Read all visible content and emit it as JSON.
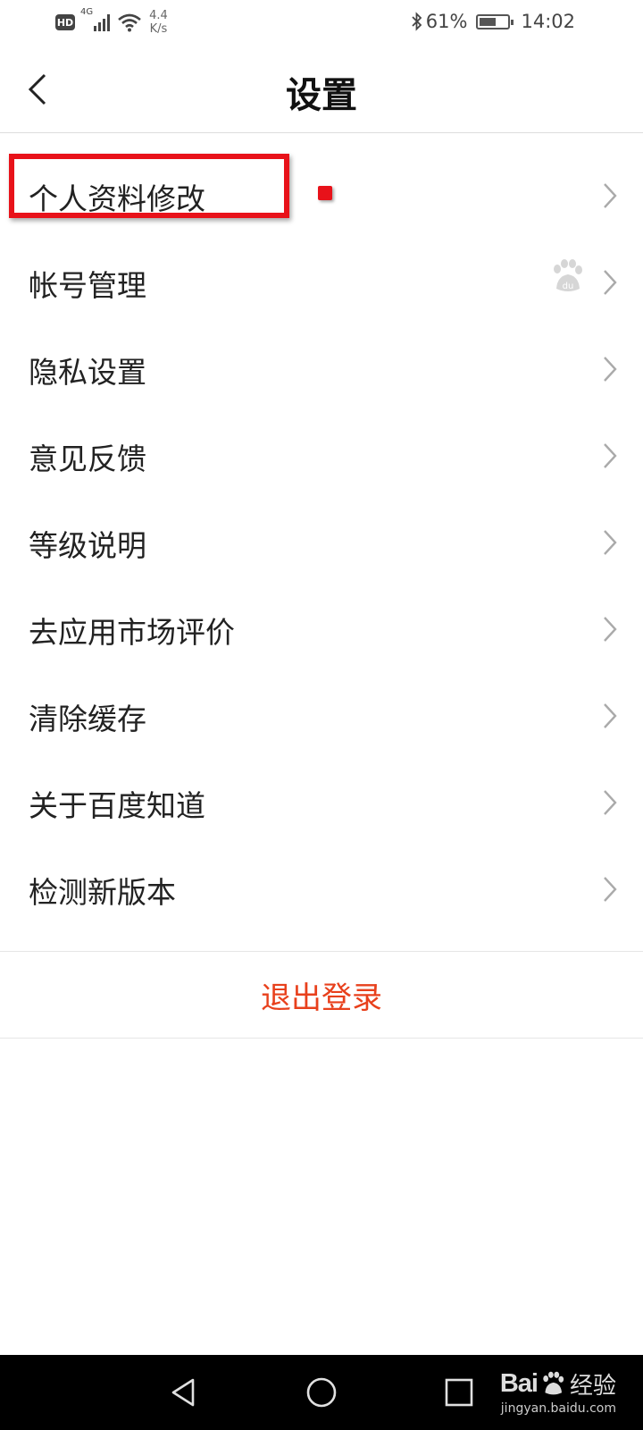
{
  "status_bar": {
    "hd_badge": "HD",
    "network_label": "4G",
    "speed_value": "4.4",
    "speed_unit": "K/s",
    "battery_percent": "61%",
    "battery_level": 0.61,
    "time": "14:02",
    "icons": [
      "hd-icon",
      "signal-icon",
      "wifi-icon",
      "bluetooth-icon",
      "battery-icon"
    ]
  },
  "header": {
    "title": "设置",
    "back_icon": "chevron-left-icon"
  },
  "menu": {
    "items": [
      {
        "label": "个人资料修改",
        "highlighted": true
      },
      {
        "label": "帐号管理",
        "badge_icon": "baidu-paw-icon"
      },
      {
        "label": "隐私设置"
      },
      {
        "label": "意见反馈"
      },
      {
        "label": "等级说明"
      },
      {
        "label": "去应用市场评价"
      },
      {
        "label": "清除缓存"
      },
      {
        "label": "关于百度知道"
      },
      {
        "label": "检测新版本"
      }
    ],
    "chevron_icon": "chevron-right-icon"
  },
  "logout": {
    "label": "退出登录",
    "color": "#e8401c"
  },
  "annotation": {
    "color": "#e8121a"
  },
  "nav_bar": {
    "icons": [
      "back-triangle-icon",
      "home-circle-icon",
      "recents-square-icon"
    ]
  },
  "watermark": {
    "brand": "Bai",
    "brand_suffix": "经验",
    "url": "jingyan.baidu.com"
  }
}
